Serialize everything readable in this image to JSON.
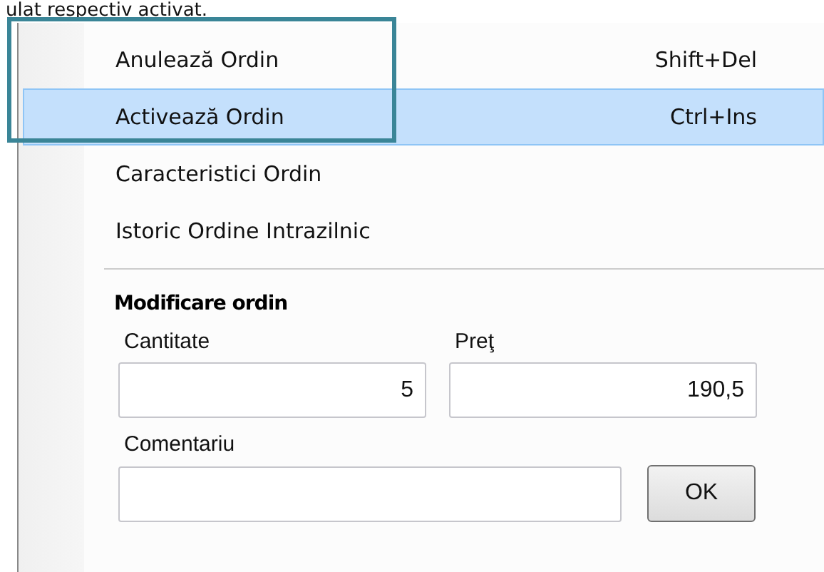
{
  "caption": "ulat respectiv activat.",
  "menu": {
    "items": [
      {
        "label": "Anulează Ordin",
        "shortcut": "Shift+Del",
        "selected": false
      },
      {
        "label": "Activează Ordin",
        "shortcut": "Ctrl+Ins",
        "selected": true
      },
      {
        "label": "Caracteristici Ordin",
        "selected": false
      },
      {
        "label": "Istoric Ordine Intrazilnic",
        "selected": false
      }
    ]
  },
  "modify_order": {
    "title": "Modificare ordin",
    "quantity": {
      "label": "Cantitate",
      "value": "5"
    },
    "price": {
      "label": "Preţ",
      "value": "190,5"
    },
    "comment": {
      "label": "Comentariu"
    },
    "ok_button": "OK"
  }
}
